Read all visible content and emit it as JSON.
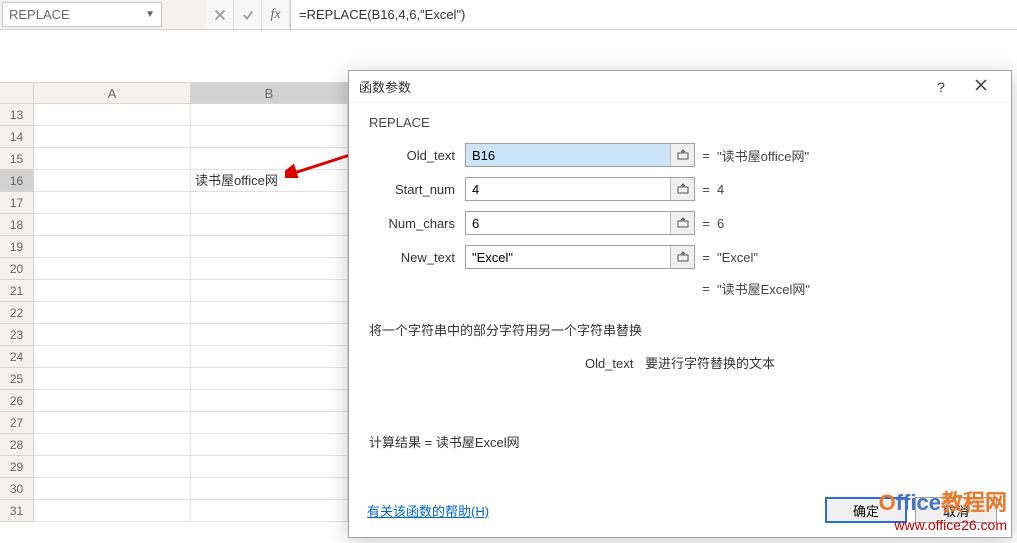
{
  "namebox": {
    "value": "REPLACE"
  },
  "formula_bar": {
    "formula": "=REPLACE(B16,4,6,\"Excel\")"
  },
  "columns": [
    "A",
    "B"
  ],
  "rows": [
    13,
    14,
    15,
    16,
    17,
    18,
    19,
    20,
    21,
    22,
    23,
    24,
    25,
    26,
    27,
    28,
    29,
    30,
    31
  ],
  "active_row": 16,
  "cells": {
    "B16": "读书屋office网"
  },
  "dialog": {
    "title": "函数参数",
    "function_name": "REPLACE",
    "args": [
      {
        "label": "Old_text",
        "value": "B16",
        "evaluated": "\"读书屋office网\"",
        "selected": true
      },
      {
        "label": "Start_num",
        "value": "4",
        "evaluated": "4"
      },
      {
        "label": "Num_chars",
        "value": "6",
        "evaluated": "6"
      },
      {
        "label": "New_text",
        "value": "\"Excel\"",
        "evaluated": "\"Excel\""
      }
    ],
    "result_inline": "\"读书屋Excel网\"",
    "description": "将一个字符串中的部分字符用另一个字符串替换",
    "arg_help_label": "Old_text",
    "arg_help_text": "要进行字符替换的文本",
    "calc_result_label": "计算结果 =",
    "calc_result_value": "读书屋Excel网",
    "help_link": "有关该函数的帮助(H)",
    "ok": "确定",
    "cancel": "取消"
  },
  "watermark": {
    "brand_o": "O",
    "brand_rest": "ffice",
    "brand_cn": "教程网",
    "url": "www.office26.com"
  }
}
